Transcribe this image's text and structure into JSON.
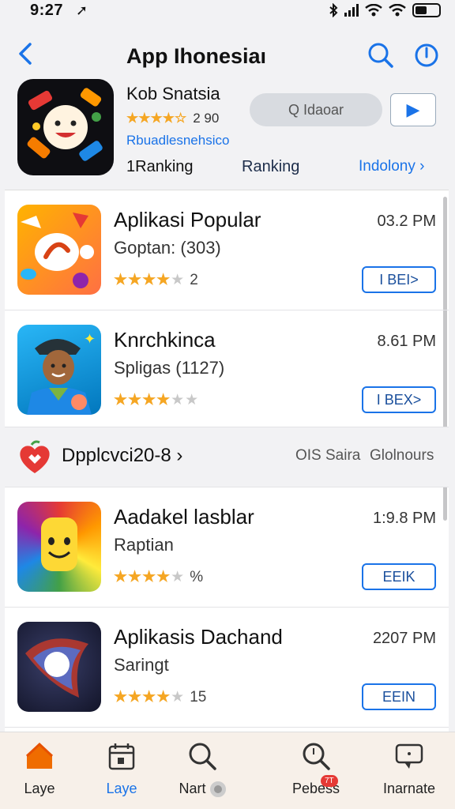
{
  "status_bar": {
    "time": "9:27",
    "location_arrow": "➚"
  },
  "nav": {
    "back_icon": "chevron-left",
    "title": "App Ihonesiaı"
  },
  "featured_app": {
    "name": "Kob Snatsia",
    "rating_stars": "★★★★☆",
    "rating_value": "2 90",
    "developer": "Rbuadlesnehsico",
    "get_label": "Q Idaoar",
    "play_symbol": "▶",
    "rank_left": "1Ranking",
    "rank_mid": "Ranking",
    "rank_right": "Indolony ›"
  },
  "apps": [
    {
      "title": "Aplikasi Popular",
      "subtitle": "Goptan: (303)",
      "stars": "★★★★",
      "stars_empty": "★",
      "rating_note": "2",
      "time": "03.2 PM",
      "button": "I BEI>"
    },
    {
      "title": "Knrchkinca",
      "subtitle": "Spligas (1127)",
      "stars": "★★★★",
      "stars_empty": "★★",
      "rating_note": "",
      "time": "8.61 PM",
      "button": "I BEX>"
    },
    {
      "title": "Aadakel lasblar",
      "subtitle": "Raptian",
      "stars": "★★★★",
      "stars_empty": "★",
      "rating_note": "%",
      "time": "1:9.8 PM",
      "button": "EEIK"
    },
    {
      "title": "Aplikasis Dachand",
      "subtitle": "Saringt",
      "stars": "★★★★",
      "stars_empty": "★",
      "rating_note": "15",
      "time": "2207 PM",
      "button": "EEIN"
    }
  ],
  "section": {
    "label": "Dpplcvci20-8 ›",
    "right_1": "OIS Saira",
    "right_2": "Glolnours"
  },
  "tabs": [
    {
      "label": "Laye",
      "icon": "home-icon",
      "active": false
    },
    {
      "label": "Laye",
      "icon": "calendar-icon",
      "active": true
    },
    {
      "label": "Nart",
      "icon": "search-icon",
      "active": false
    },
    {
      "label": "Pebess",
      "icon": "search-icon",
      "badge": "7T",
      "active": false
    },
    {
      "label": "Inarnate",
      "icon": "chat-icon",
      "active": false
    }
  ],
  "colors": {
    "accent": "#1a73e8",
    "star": "#f5a623",
    "tab_bg": "#f7f0e9"
  }
}
